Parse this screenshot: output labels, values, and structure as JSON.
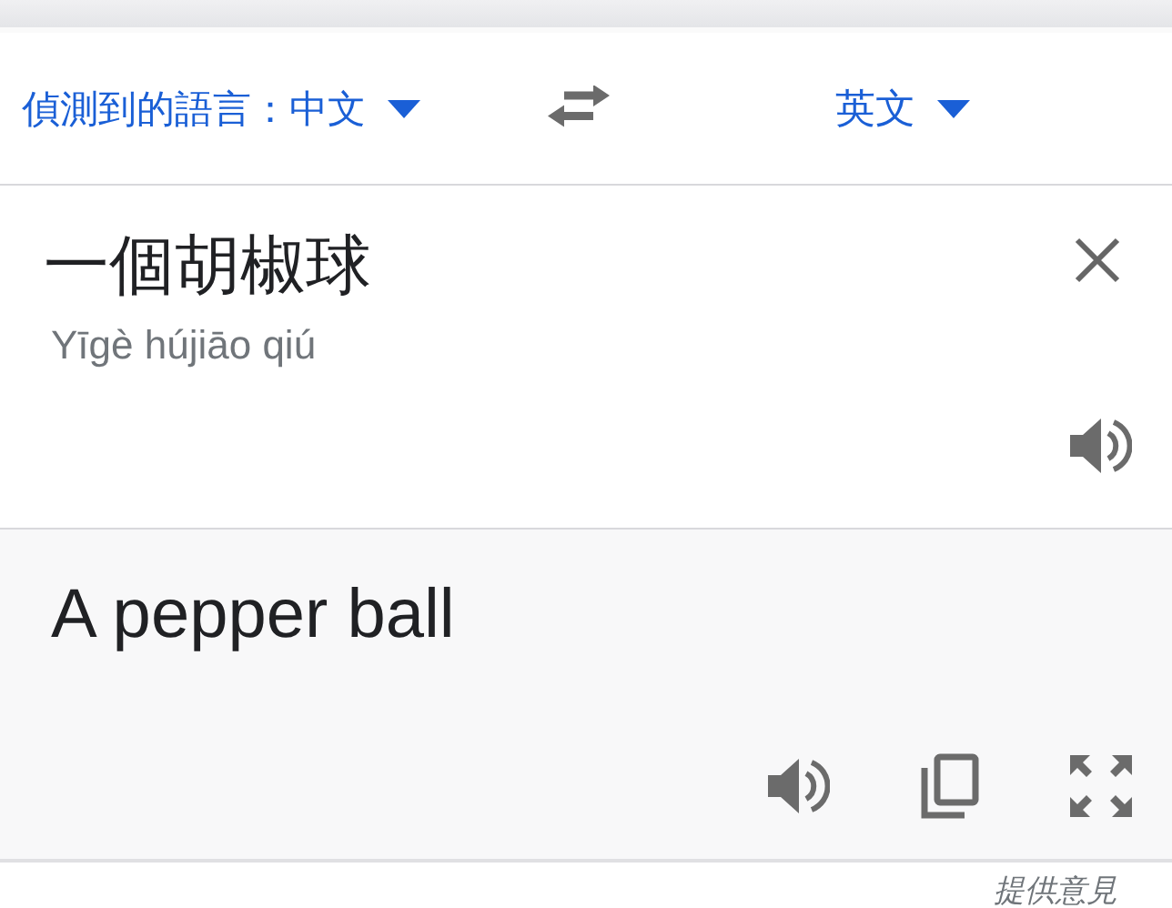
{
  "language_bar": {
    "source_language": "偵測到的語言：中文",
    "target_language": "英文"
  },
  "source": {
    "text": "一個胡椒球",
    "romanization": "Yīgè hújiāo qiú"
  },
  "translation": {
    "text": "A pepper ball"
  },
  "footer": {
    "feedback_link": "提供意見"
  }
}
